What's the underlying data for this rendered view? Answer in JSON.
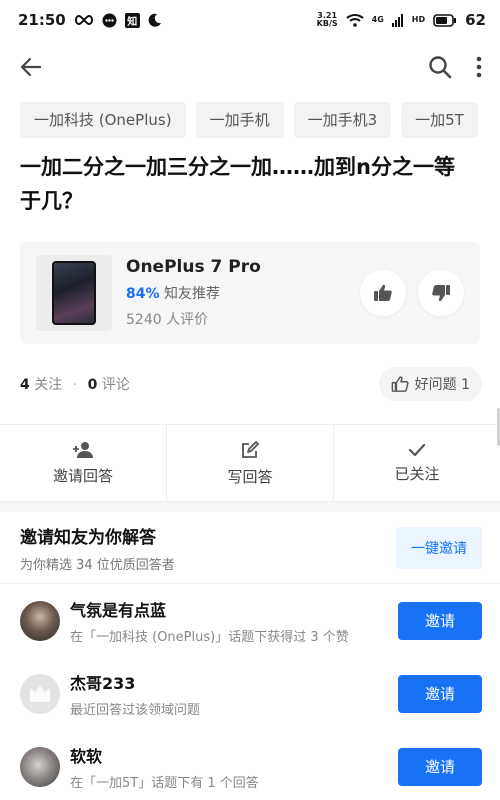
{
  "status_bar": {
    "time": "21:50",
    "net_speed_value": "3.21",
    "net_speed_unit": "KB/S",
    "network": "4G",
    "hd": "HD",
    "battery": "62",
    "notif_k": "知"
  },
  "tags": [
    "一加科技 (OnePlus)",
    "一加手机",
    "一加手机3",
    "一加5T"
  ],
  "question": {
    "title": "一加二分之一加三分之一加……加到n分之一等于几？"
  },
  "product": {
    "name": "OnePlus 7 Pro",
    "recommend_pct": "84%",
    "recommend_label": "知友推荐",
    "reviews": "5240 人评价"
  },
  "meta": {
    "follow_count": "4",
    "follow_label": "关注",
    "comment_count": "0",
    "comment_label": "评论",
    "good_question_label": "好问题 1"
  },
  "actions": {
    "invite_label": "邀请回答",
    "write_label": "写回答",
    "followed_label": "已关注"
  },
  "invite_section": {
    "title": "邀请知友为你解答",
    "subtitle": "为你精选 34 位优质回答者",
    "one_key_label": "一键邀请",
    "users": [
      {
        "name": "气氛是有点蓝",
        "desc": "在「一加科技 (OnePlus)」话题下获得过 3 个赞",
        "button": "邀请"
      },
      {
        "name": "杰哥233",
        "desc": "最近回答过该领域问题",
        "button": "邀请"
      },
      {
        "name": "软软",
        "desc": "在「一加5T」话题下有 1 个回答",
        "button": "邀请"
      }
    ]
  },
  "colors": {
    "accent": "#1772f6",
    "accent_light": "#ebf5ff"
  }
}
